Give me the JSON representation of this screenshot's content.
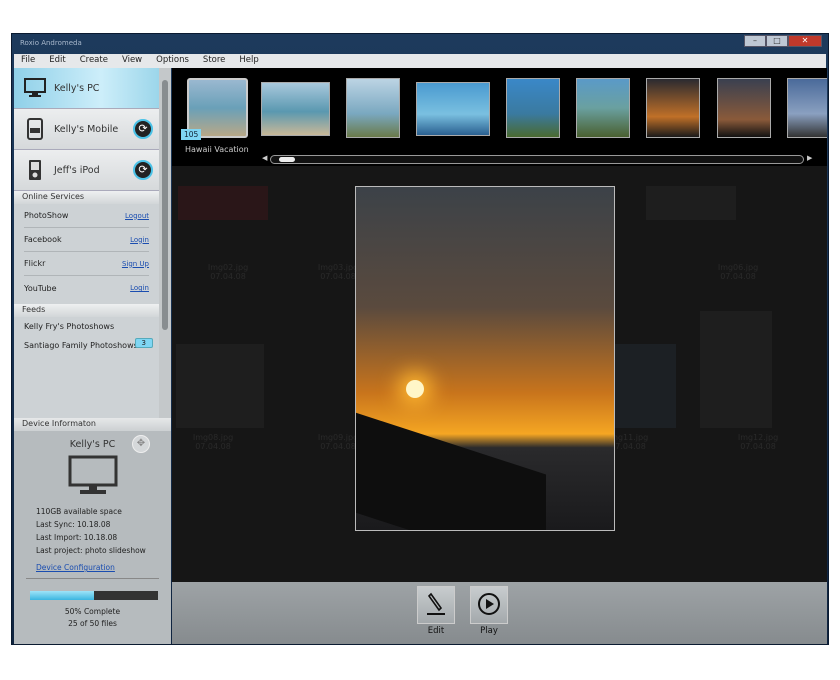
{
  "window": {
    "title": "Roxio Andromeda",
    "controls": [
      "–",
      "□",
      "✕"
    ]
  },
  "menu": [
    "File",
    "Edit",
    "Create",
    "View",
    "Options",
    "Store",
    "Help"
  ],
  "devices": [
    {
      "name": "Kelly's PC",
      "icon": "monitor-icon",
      "selected": true
    },
    {
      "name": "Kelly's Mobile",
      "icon": "mobile-icon"
    },
    {
      "name": "Jeff's iPod",
      "icon": "ipod-icon"
    }
  ],
  "online_services": {
    "title": "Online Services",
    "items": [
      {
        "name": "PhotoShow",
        "action": "Logout"
      },
      {
        "name": "Facebook",
        "action": "Login"
      },
      {
        "name": "Flickr",
        "action": "Sign Up"
      },
      {
        "name": "YouTube",
        "action": "Login"
      }
    ]
  },
  "feeds": {
    "title": "Feeds",
    "items": [
      {
        "name": "Kelly Fry's Photoshows",
        "badge": ""
      },
      {
        "name": "Santiago Family Photoshows",
        "badge": "3"
      }
    ]
  },
  "device_info": {
    "title": "Device Informaton",
    "name": "Kelly's PC",
    "lines": [
      "110GB available space",
      "Last Sync: 10.18.08",
      "Last Import: 10.18.08",
      "Last project: photo slideshow"
    ],
    "config_link": "Device Configuration",
    "progress_percent": 50,
    "progress_text": "50% Complete",
    "files_text": "25 of 50 files",
    "accent": "#4cc3e8"
  },
  "filmstrip": {
    "album_count": "105",
    "album_name": "Hawaii Vacation",
    "scroll_position": 0.02
  },
  "grid": [
    {
      "name": "Img02.jpg",
      "date": "07.04.08"
    },
    {
      "name": "Img03.jpg",
      "date": "07.04.08"
    },
    {
      "name": "Img06.jpg",
      "date": "07.04.08"
    },
    {
      "name": "Img08.jpg",
      "date": "07.04.08"
    },
    {
      "name": "Img09.jpg",
      "date": "07.04.08"
    },
    {
      "name": "Img11.jpg",
      "date": "07.04.08"
    },
    {
      "name": "Img12.jpg",
      "date": "07.04.08"
    }
  ],
  "toolbar": {
    "edit": "Edit",
    "play": "Play"
  }
}
